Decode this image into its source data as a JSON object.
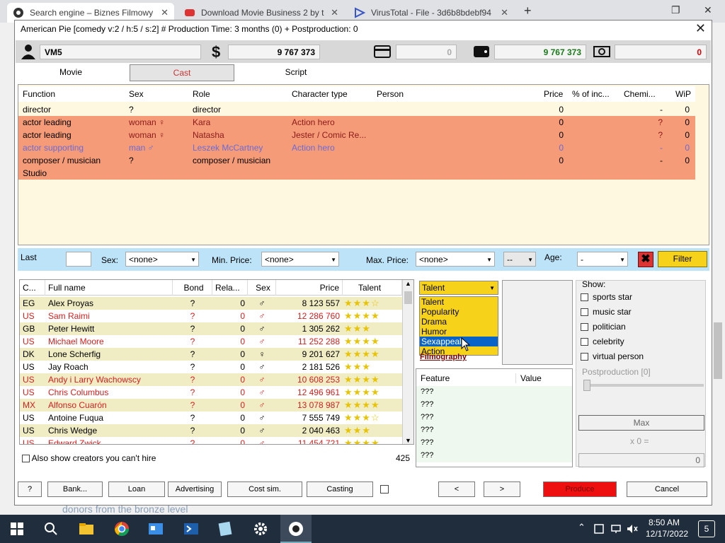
{
  "browser": {
    "tabs": [
      {
        "label": "Search engine – Biznes Filmowy"
      },
      {
        "label": "Download Movie Business 2 by t"
      },
      {
        "label": "VirusTotal - File - 3d6b8bdebf94"
      }
    ],
    "new_tab": "+"
  },
  "dialog": {
    "title": "American Pie [comedy v:2 / h:5 / s:2] # Production Time: 3  months (0) + Postproduction: 0",
    "close": "✕"
  },
  "money": {
    "studio": "VM5",
    "balance": "9 767 373",
    "card": "0",
    "wallet": "9 767 373",
    "debt": "0"
  },
  "tabs": [
    {
      "label": "Movie"
    },
    {
      "label": "Cast"
    },
    {
      "label": "Script"
    }
  ],
  "cast": {
    "columns": [
      "Function",
      "Sex",
      "Role",
      "Character type",
      "Person",
      "Price",
      "% of inc...",
      "Chemi...",
      "WiP"
    ],
    "rows": [
      {
        "function": "director",
        "sex": "?",
        "role": "director",
        "type": "",
        "person": "",
        "price": "0",
        "pct": "",
        "chem": "-",
        "wip": "0"
      },
      {
        "function": "actor leading",
        "sex": "woman ♀",
        "role": "Kara",
        "type": "Action hero",
        "person": "",
        "price": "0",
        "pct": "",
        "chem": "?",
        "wip": "0"
      },
      {
        "function": "actor leading",
        "sex": "woman ♀",
        "role": "Natasha",
        "type": "Jester / Comic Re...",
        "person": "",
        "price": "0",
        "pct": "",
        "chem": "?",
        "wip": "0"
      },
      {
        "function": "actor supporting",
        "sex": "man ♂",
        "role": "Leszek McCartney",
        "type": "Action hero",
        "person": "",
        "price": "0",
        "pct": "",
        "chem": "-",
        "wip": "0"
      },
      {
        "function": "composer / musician",
        "sex": "?",
        "role": "composer / musician",
        "type": "",
        "person": "",
        "price": "0",
        "pct": "",
        "chem": "-",
        "wip": "0"
      },
      {
        "function": "Studio",
        "sex": "",
        "role": "",
        "type": "",
        "person": "",
        "price": "",
        "pct": "",
        "chem": "",
        "wip": ""
      }
    ]
  },
  "filter": {
    "last_label": "Last",
    "sex_label": "Sex:",
    "sex_value": "<none>",
    "minprice_label": "Min. Price:",
    "minprice_value": "<none>",
    "maxprice_label": "Max. Price:",
    "maxprice_value": "<none>",
    "dash_value": "--",
    "age_label": "Age:",
    "age_value": "-",
    "filter_button": "Filter"
  },
  "candidates": {
    "columns": [
      "C...",
      "Full name",
      "Bond",
      "Rela...",
      "Sex",
      "Price",
      "Talent"
    ],
    "rows": [
      {
        "c": "EG",
        "name": "Alex Proyas",
        "bond": "?",
        "rel": "0",
        "sex": "♂",
        "price": "8 123 557",
        "stars": "★★★☆",
        "red": false
      },
      {
        "c": "US",
        "name": "Sam Raimi",
        "bond": "?",
        "rel": "0",
        "sex": "♂",
        "price": "12 286 760",
        "stars": "★★★★",
        "red": true
      },
      {
        "c": "GB",
        "name": "Peter Hewitt",
        "bond": "?",
        "rel": "0",
        "sex": "♂",
        "price": "1 305 262",
        "stars": "★★★",
        "red": false
      },
      {
        "c": "US",
        "name": "Michael Moore",
        "bond": "?",
        "rel": "0",
        "sex": "♂",
        "price": "11 252 288",
        "stars": "★★★★",
        "red": true
      },
      {
        "c": "DK",
        "name": "Lone Scherfig",
        "bond": "?",
        "rel": "0",
        "sex": "♀",
        "price": "9 201 627",
        "stars": "★★★★",
        "red": false
      },
      {
        "c": "US",
        "name": "Jay Roach",
        "bond": "?",
        "rel": "0",
        "sex": "♂",
        "price": "2 181 526",
        "stars": "★★★",
        "red": false
      },
      {
        "c": "US",
        "name": "Andy i Larry Wachowscy",
        "bond": "?",
        "rel": "0",
        "sex": "♂",
        "price": "10 608 253",
        "stars": "★★★★",
        "red": true
      },
      {
        "c": "US",
        "name": "Chris Columbus",
        "bond": "?",
        "rel": "0",
        "sex": "♂",
        "price": "12 496 961",
        "stars": "★★★★",
        "red": true
      },
      {
        "c": "MX",
        "name": "Alfonso Cuarón",
        "bond": "?",
        "rel": "0",
        "sex": "♂",
        "price": "13 078 987",
        "stars": "★★★★",
        "red": true
      },
      {
        "c": "US",
        "name": "Antoine Fuqua",
        "bond": "?",
        "rel": "0",
        "sex": "♂",
        "price": "7 555 749",
        "stars": "★★★☆",
        "red": false
      },
      {
        "c": "US",
        "name": "Chris Wedge",
        "bond": "?",
        "rel": "0",
        "sex": "♂",
        "price": "2 040 463",
        "stars": "★★★",
        "red": false
      },
      {
        "c": "US",
        "name": "Edward Zwick",
        "bond": "?",
        "rel": "0",
        "sex": "♂",
        "price": "11 454 721",
        "stars": "★★★★",
        "red": true
      }
    ],
    "also_show": "Also show creators you can't hire",
    "count": "425"
  },
  "sort": {
    "selected": "Talent",
    "options": [
      "Talent",
      "Popularity",
      "Drama",
      "Humor",
      "Sexappeal",
      "Action"
    ],
    "highlighted": "Sexappeal",
    "filmography": "Filmography"
  },
  "features": {
    "columns": [
      "Feature",
      "Value"
    ],
    "rows": [
      "???",
      "???",
      "???",
      "???",
      "???",
      "???"
    ]
  },
  "show": {
    "label": "Show:",
    "items": [
      "sports star",
      "music star",
      "politician",
      "celebrity",
      "virtual person"
    ],
    "postprod": "Postproduction [0]",
    "max": "Max",
    "multiplier": "x 0 =",
    "result": "0"
  },
  "buttons": {
    "help": "?",
    "bank": "Bank...",
    "loan": "Loan",
    "advertising": "Advertising",
    "costsim": "Cost sim.",
    "casting": "Casting",
    "prev": "<",
    "next": ">",
    "produce": "Produce",
    "cancel": "Cancel"
  },
  "underlay": "donors from the bronze level",
  "taskbar": {
    "time": "8:50 AM",
    "date": "12/17/2022",
    "notif": "5"
  }
}
